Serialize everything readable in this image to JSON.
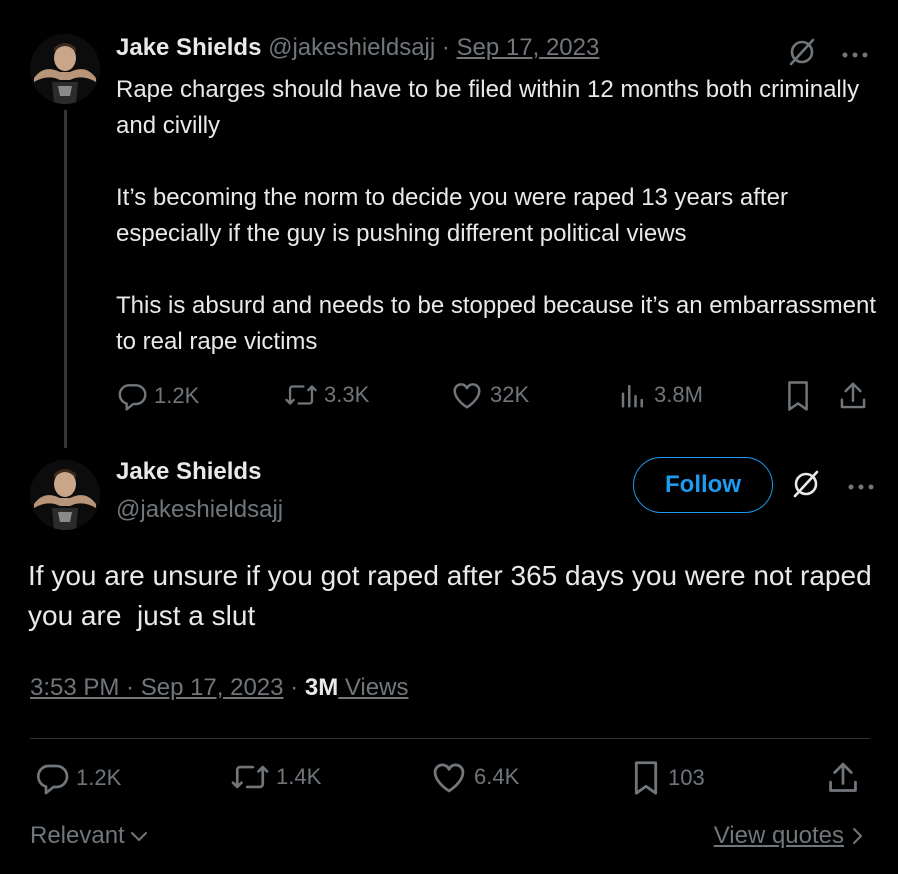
{
  "parent_tweet": {
    "author_name": "Jake Shields",
    "handle": "@jakeshieldsajj",
    "separator": "·",
    "date": "Sep 17, 2023",
    "text": "Rape charges should have to be filed within 12 months both criminally and civilly\n\nIt’s becoming the norm to decide you were raped 13 years after especially if the guy is pushing different political views\n\nThis is absurd and needs to be stopped because it’s an embarrassment to real rape victims",
    "replies": "1.2K",
    "reposts": "3.3K",
    "likes": "32K",
    "views": "3.8M"
  },
  "main_tweet": {
    "author_name": "Jake Shields",
    "handle": "@jakeshieldsajj",
    "follow_label": "Follow",
    "text": "If you are unsure if you got raped after 365 days you were not raped you are  just a slut",
    "time_date": "3:53 PM · Sep 17, 2023",
    "separator": "·",
    "views_count": "3M",
    "views_label": " Views",
    "replies": "1.2K",
    "reposts": "1.4K",
    "likes": "6.4K",
    "bookmarks": "103"
  },
  "footer": {
    "sort_label": "Relevant",
    "view_quotes_label": "View quotes"
  },
  "colors": {
    "background": "#000000",
    "text": "#e7e9ea",
    "muted": "#71767b",
    "accent": "#1d9bf0"
  },
  "icons": [
    "grok-icon",
    "more-icon",
    "reply-icon",
    "repost-icon",
    "like-icon",
    "views-icon",
    "bookmark-icon",
    "share-icon",
    "chevron-down-icon",
    "chevron-right-icon"
  ]
}
